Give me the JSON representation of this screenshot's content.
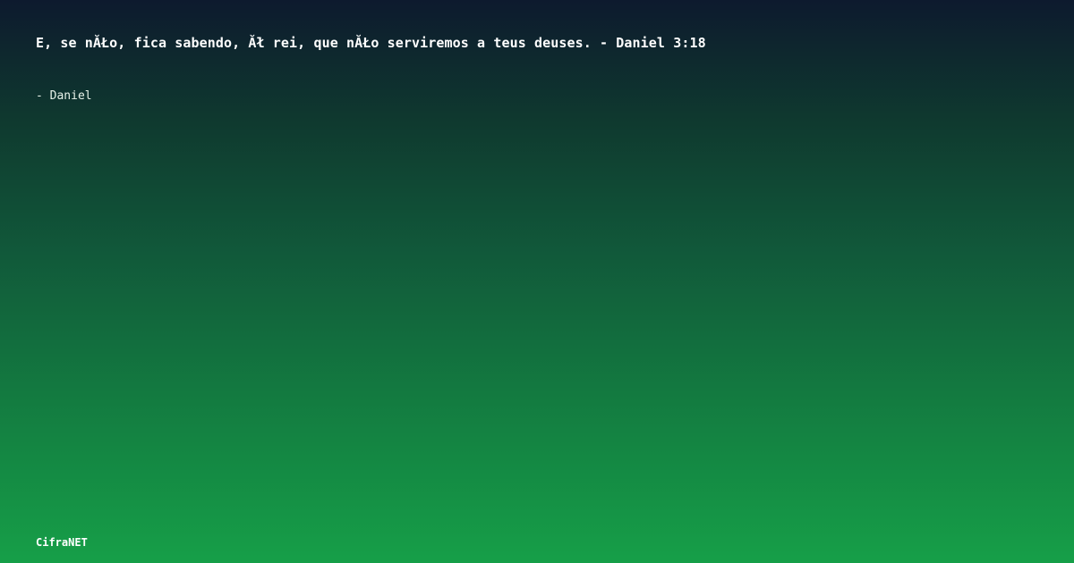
{
  "card": {
    "quote": "E, se nĂŁo, fica sabendo, Ăł rei, que nĂŁo serviremos a teus deuses. - Daniel 3:18",
    "author": "- Daniel",
    "brand": "CifraNET"
  },
  "colors": {
    "background_top": "#0d1a2e",
    "background_bottom": "#169f48",
    "text": "#ffffff"
  }
}
